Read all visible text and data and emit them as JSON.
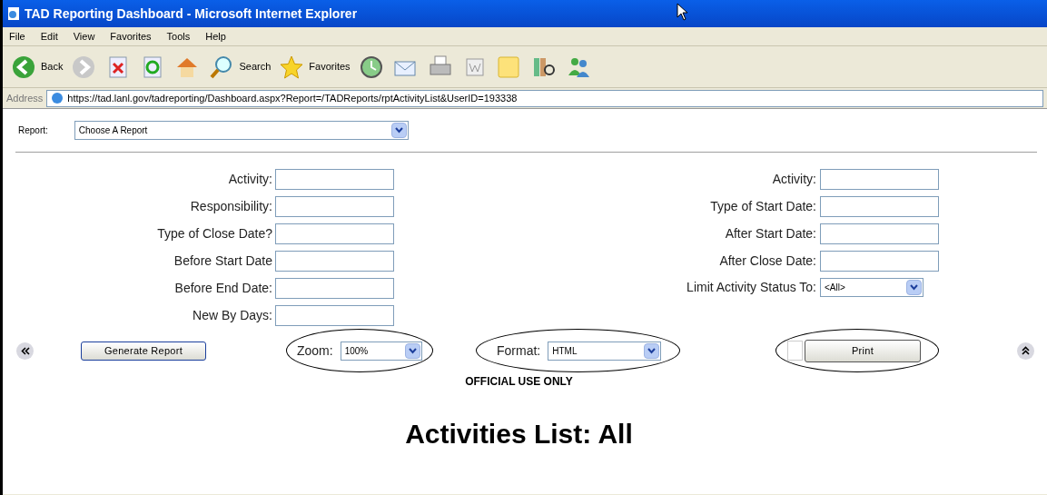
{
  "window": {
    "title": "TAD Reporting Dashboard - Microsoft Internet Explorer"
  },
  "menu": [
    "File",
    "Edit",
    "View",
    "Favorites",
    "Tools",
    "Help"
  ],
  "toolbar": [
    {
      "kind": "back",
      "label": "Back"
    },
    {
      "kind": "forward"
    },
    {
      "kind": "stop"
    },
    {
      "kind": "refresh"
    },
    {
      "kind": "home"
    },
    {
      "kind": "search",
      "label": "Search"
    },
    {
      "kind": "favorites",
      "label": "Favorites"
    },
    {
      "kind": "history"
    },
    {
      "kind": "mail"
    },
    {
      "kind": "print"
    },
    {
      "kind": "word"
    },
    {
      "kind": "note"
    },
    {
      "kind": "research"
    },
    {
      "kind": "messenger"
    }
  ],
  "address": {
    "label": "Address",
    "url": "https://tad.lanl.gov/tadreporting/Dashboard.aspx?Report=/TADReports/rptActivityList&UserID=193338"
  },
  "report": {
    "label": "Report:",
    "value": "Choose A Report"
  },
  "left_fields": [
    {
      "label": "Activity:",
      "kind": "text"
    },
    {
      "label": "Responsibility:",
      "kind": "text"
    },
    {
      "label": "Type of Close Date?",
      "kind": "text"
    },
    {
      "label": "Before Start Date",
      "kind": "text"
    },
    {
      "label": "Before End Date:",
      "kind": "text"
    },
    {
      "label": "New By Days:",
      "kind": "text"
    }
  ],
  "right_fields": [
    {
      "label": "Activity:",
      "kind": "text"
    },
    {
      "label": "Type of Start Date:",
      "kind": "text"
    },
    {
      "label": "After Start Date:",
      "kind": "text"
    },
    {
      "label": "After Close Date:",
      "kind": "text"
    },
    {
      "label": "Limit Activity Status To:",
      "kind": "select",
      "value": "<All>"
    }
  ],
  "generate_button": "Generate Report",
  "zoom": {
    "label": "Zoom:",
    "value": "100%"
  },
  "format": {
    "label": "Format:",
    "value": "HTML"
  },
  "print_checkbox": {
    "checked": false
  },
  "print_button": "Print",
  "notice": "OFFICIAL USE ONLY",
  "heading": "Activities List: All"
}
